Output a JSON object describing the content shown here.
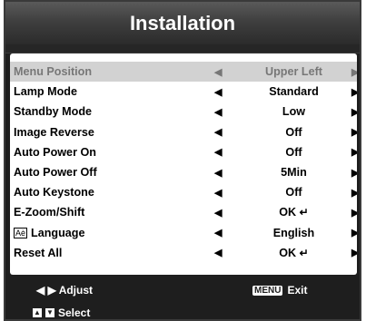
{
  "title": "Installation",
  "menu": [
    {
      "label": "Menu Position",
      "value": "Upper Left",
      "selected": true
    },
    {
      "label": "Lamp Mode",
      "value": "Standard"
    },
    {
      "label": "Standby Mode",
      "value": "Low"
    },
    {
      "label": "Image Reverse",
      "value": "Off"
    },
    {
      "label": "Auto Power On",
      "value": "Off"
    },
    {
      "label": "Auto Power Off",
      "value": "5Min"
    },
    {
      "label": "Auto Keystone",
      "value": "Off"
    },
    {
      "label": "E-Zoom/Shift",
      "value": "OK"
    },
    {
      "label": "Language",
      "value": "English"
    },
    {
      "label": "Reset All",
      "value": "OK"
    }
  ],
  "footer": {
    "adjust_arrows": "◀ ▶",
    "adjust": "Adjust",
    "menu_key": "MENU",
    "exit": "Exit",
    "select": "Select"
  },
  "icons": {
    "left": "◀",
    "right": "▶",
    "enter": "↵",
    "up": "▲",
    "down": "▼",
    "language": "Aè"
  },
  "colors": {
    "panel": "#1e1e1e",
    "selected_row": "#d2d2d2",
    "header_top": "#5a5a5a"
  }
}
